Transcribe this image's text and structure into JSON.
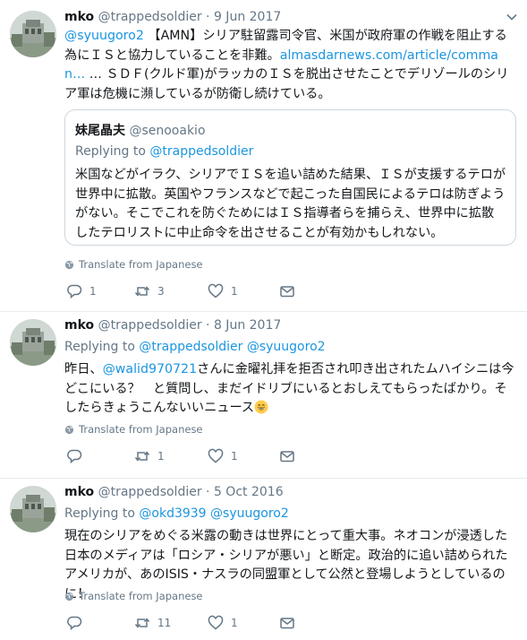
{
  "tweets": [
    {
      "name": "mko",
      "handle": "@trappedsoldier",
      "dot": "·",
      "date": "9 Jun 2017",
      "text_mention": "@syuugoro2",
      "text_part1": " 【AMN】シリア駐留露司令官、米国が政府軍の作戦を阻止する為にＩＳと協力していることを非難。",
      "text_link": "almasdarnews.com/article/comman…",
      "text_part2": " … ＳＤＦ(クルド軍)がラッカのＩＳを脱出させたことでデリゾールのシリア軍は危機に瀕しているが防衛し続けている。",
      "quote": {
        "name": "妹尾晶夫",
        "handle": "@senooakio",
        "replying_prefix": "Replying to ",
        "replying_to": "@trappedsoldier",
        "text": "米国などがイラク、シリアでＩＳを追い詰めた結果、ＩＳが支援するテロが世界中に拡散。英国やフランスなどで起こった自国民によるテロは防ぎようがない。そこでこれを防ぐためにはＩＳ指導者らを捕らえ、世界中に拡散したテロリストに中止命令を出させることが有効かもしれない。"
      },
      "translate": "Translate from Japanese",
      "reply_count": "1",
      "retweet_count": "3",
      "like_count": "1"
    },
    {
      "name": "mko",
      "handle": "@trappedsoldier",
      "dot": "·",
      "date": "8 Jun 2017",
      "replying_prefix": "Replying to ",
      "replying_to_1": "@trappedsoldier",
      "replying_to_2": "@syuugoro2",
      "text_part1": "昨日、",
      "text_mention": "@walid970721",
      "text_part2": "さんに金曜礼拝を拒否され叩き出されたムハイシニは今どこにいる？　と質問し、まだイドリブにいるとおしえてもらったばかり。そしたらきょうこんないいニュース",
      "translate": "Translate from Japanese",
      "reply_count": "",
      "retweet_count": "1",
      "like_count": "1"
    },
    {
      "name": "mko",
      "handle": "@trappedsoldier",
      "dot": "·",
      "date": "5 Oct 2016",
      "replying_prefix": "Replying to ",
      "replying_to_1": "@okd3939",
      "replying_to_2": "@syuugoro2",
      "text": "現在のシリアをめぐる米露の動きは世界にとって重大事。ネオコンが浸透した日本のメディアは「ロシア・シリアが悪い」と断定。政治的に追い詰められたアメリカが、あのISIS・ナスラの同盟軍として公然と登場しようとしているのに！",
      "translate": "Translate from Japanese",
      "reply_count": "",
      "retweet_count": "11",
      "like_count": "1"
    }
  ],
  "colors": {
    "link": "#1b95e0",
    "muted": "#657786",
    "text": "#14171a",
    "border": "#e6ecf0"
  },
  "icons": [
    "avatar",
    "chevron-down-icon",
    "globe-icon",
    "reply-icon",
    "retweet-icon",
    "heart-icon",
    "envelope-icon",
    "grinning-emoji-icon"
  ]
}
